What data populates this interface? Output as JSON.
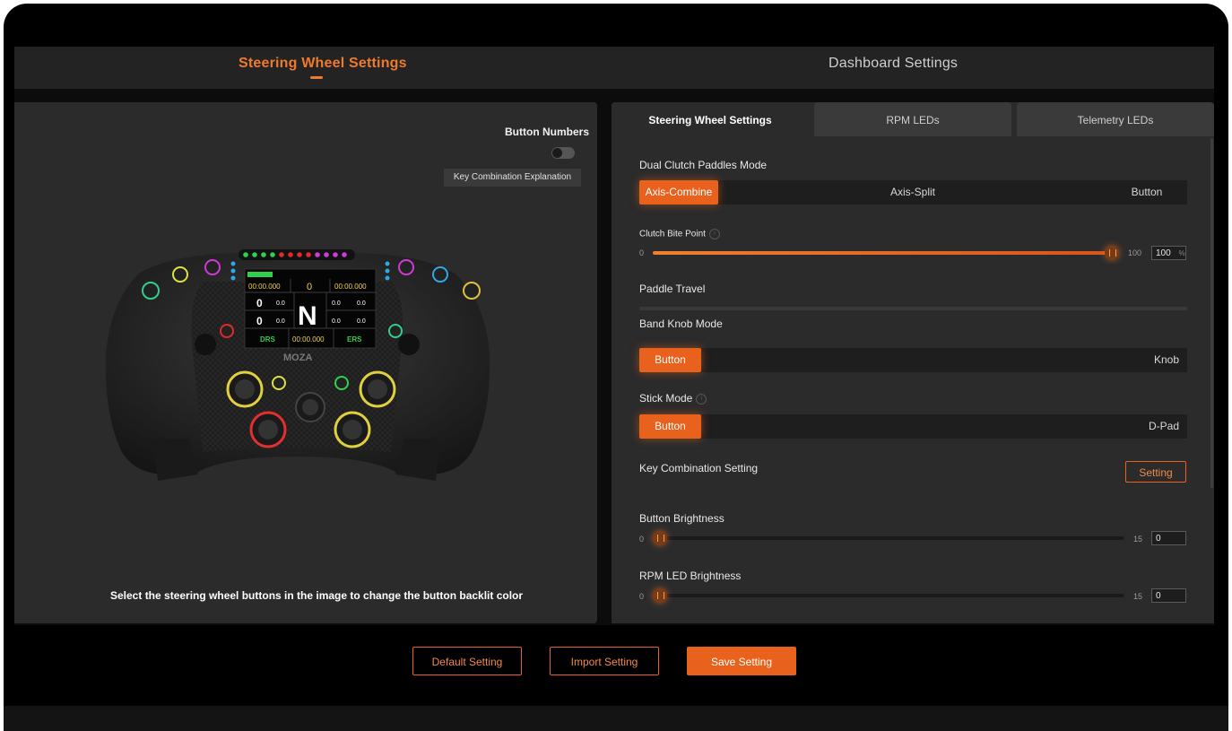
{
  "top_tabs": [
    {
      "label": "Steering Wheel Settings",
      "active": true
    },
    {
      "label": "Dashboard Settings",
      "active": false
    }
  ],
  "left": {
    "button_numbers_label": "Button Numbers",
    "button_numbers_on": false,
    "key_combination_explanation": "Key Combination Explanation",
    "help_text": "Select the steering wheel buttons in the image to change the button backlit color",
    "wheel_display": {
      "lap_time_left": "00:00.000",
      "lap_count": "0",
      "lap_time_right": "00:00.000",
      "gear": "N",
      "left_top": "0",
      "left_top_val": "0.0",
      "left_bottom": "0",
      "left_bottom_val": "0.0",
      "right_top_val": "0.0",
      "right_top_val2": "0.0",
      "right_bottom_val": "0.0",
      "right_bottom_val2": "0.0",
      "drs": "DRS",
      "center_time": "00:00.000",
      "ers": "ERS",
      "brand": "MOZA"
    }
  },
  "right": {
    "sub_tabs": [
      {
        "label": "Steering Wheel Settings",
        "active": true
      },
      {
        "label": "RPM LEDs",
        "active": false
      },
      {
        "label": "Telemetry LEDs",
        "active": false
      }
    ],
    "dual_clutch": {
      "label": "Dual Clutch Paddles Mode",
      "options": [
        "Axis-Combine",
        "Axis-Split",
        "Button"
      ],
      "selected": "Axis-Combine"
    },
    "clutch_bite": {
      "label": "Clutch Bite Point",
      "min": "0",
      "max": "100",
      "value": "100",
      "unit": "%",
      "fraction": 1.0
    },
    "paddle_travel": {
      "label": "Paddle Travel"
    },
    "band_knob": {
      "label": "Band Knob Mode",
      "options": [
        "Button",
        "Knob"
      ],
      "selected": "Button"
    },
    "stick_mode": {
      "label": "Stick Mode",
      "options": [
        "Button",
        "D-Pad"
      ],
      "selected": "Button"
    },
    "key_combination": {
      "label": "Key Combination Setting",
      "button": "Setting"
    },
    "button_brightness": {
      "label": "Button  Brightness",
      "min": "0",
      "max": "15",
      "value": "0",
      "fraction": 0.0
    },
    "rpm_brightness": {
      "label": "RPM LED Brightness",
      "min": "0",
      "max": "15",
      "value": "0",
      "fraction": 0.0
    }
  },
  "bottom_buttons": {
    "default": "Default Setting",
    "import": "Import Setting",
    "save": "Save Setting"
  },
  "colors": {
    "accent": "#e8621d",
    "panel": "#2b2b2b",
    "background": "#0c0c0c"
  }
}
